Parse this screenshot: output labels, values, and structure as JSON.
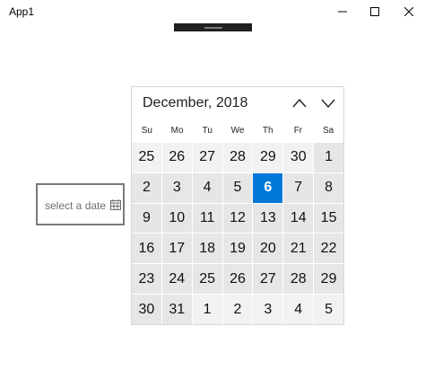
{
  "window": {
    "title": "App1"
  },
  "picker": {
    "placeholder": "select a date"
  },
  "calendar": {
    "month_label": "December, 2018",
    "weekdays": [
      "Su",
      "Mo",
      "Tu",
      "We",
      "Th",
      "Fr",
      "Sa"
    ],
    "days": [
      {
        "label": "25",
        "kind": "other"
      },
      {
        "label": "26",
        "kind": "other"
      },
      {
        "label": "27",
        "kind": "other"
      },
      {
        "label": "28",
        "kind": "other"
      },
      {
        "label": "29",
        "kind": "other"
      },
      {
        "label": "30",
        "kind": "other"
      },
      {
        "label": "1",
        "kind": "current"
      },
      {
        "label": "2",
        "kind": "current"
      },
      {
        "label": "3",
        "kind": "current"
      },
      {
        "label": "4",
        "kind": "current"
      },
      {
        "label": "5",
        "kind": "current"
      },
      {
        "label": "6",
        "kind": "today"
      },
      {
        "label": "7",
        "kind": "current"
      },
      {
        "label": "8",
        "kind": "current"
      },
      {
        "label": "9",
        "kind": "current"
      },
      {
        "label": "10",
        "kind": "current"
      },
      {
        "label": "11",
        "kind": "current"
      },
      {
        "label": "12",
        "kind": "current"
      },
      {
        "label": "13",
        "kind": "current"
      },
      {
        "label": "14",
        "kind": "current"
      },
      {
        "label": "15",
        "kind": "current"
      },
      {
        "label": "16",
        "kind": "current"
      },
      {
        "label": "17",
        "kind": "current"
      },
      {
        "label": "18",
        "kind": "current"
      },
      {
        "label": "19",
        "kind": "current"
      },
      {
        "label": "20",
        "kind": "current"
      },
      {
        "label": "21",
        "kind": "current"
      },
      {
        "label": "22",
        "kind": "current"
      },
      {
        "label": "23",
        "kind": "current"
      },
      {
        "label": "24",
        "kind": "current"
      },
      {
        "label": "25",
        "kind": "current"
      },
      {
        "label": "26",
        "kind": "current"
      },
      {
        "label": "27",
        "kind": "current"
      },
      {
        "label": "28",
        "kind": "current"
      },
      {
        "label": "29",
        "kind": "current"
      },
      {
        "label": "30",
        "kind": "current"
      },
      {
        "label": "31",
        "kind": "current"
      },
      {
        "label": "1",
        "kind": "other"
      },
      {
        "label": "2",
        "kind": "other"
      },
      {
        "label": "3",
        "kind": "other"
      },
      {
        "label": "4",
        "kind": "other"
      },
      {
        "label": "5",
        "kind": "other"
      }
    ]
  },
  "colors": {
    "accent": "#0078d7",
    "in_month": "#e6e6e6",
    "out_month": "#f2f2f2"
  }
}
